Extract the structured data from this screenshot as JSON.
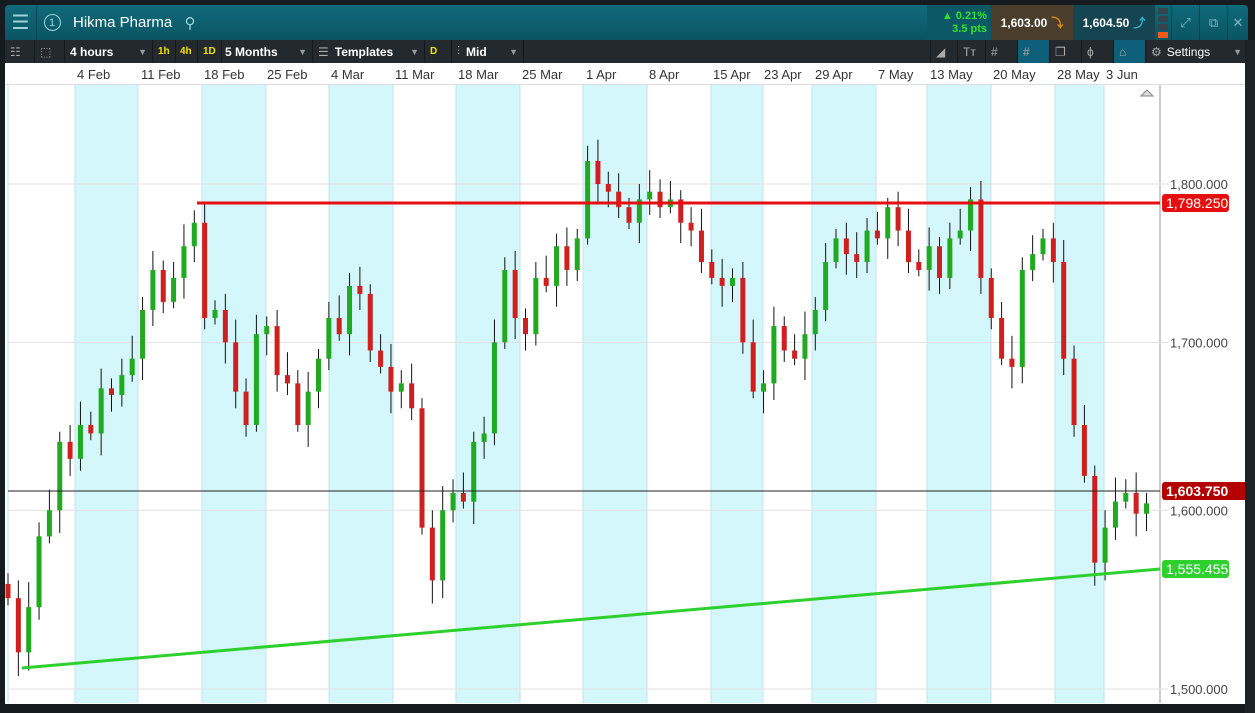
{
  "title": {
    "instrument": "Hikma Pharma",
    "watch_count": "1",
    "change_pct": "▲ 0.21%",
    "change_pts": "3.5 pts",
    "sell": "1,603.00",
    "buy": "1,604.50"
  },
  "toolbar": {
    "interval": "4 hours",
    "q1": "1h",
    "q2": "4h",
    "q3": "1D",
    "range": "5 Months",
    "templates": "Templates",
    "d": "D",
    "price_type": "Mid",
    "settings": "Settings"
  },
  "date_labels": [
    "4 Feb",
    "11 Feb",
    "18 Feb",
    "25 Feb",
    "4 Mar",
    "11 Mar",
    "18 Mar",
    "25 Mar",
    "1 Apr",
    "8 Apr",
    "15 Apr",
    "23 Apr",
    "29 Apr",
    "7 May",
    "13 May",
    "20 May",
    "28 May",
    "3 Jun"
  ],
  "chart_data": {
    "type": "candlestick",
    "y_ticks": [
      "1,800.000",
      "1,700.000",
      "1,600.000",
      "1,500.000"
    ],
    "y_tick_values": [
      1800,
      1700,
      1600,
      1500
    ],
    "ylim": [
      1490,
      1870
    ],
    "scale": "log",
    "resistance": {
      "label": "1,798.250",
      "value": 1798.25,
      "color": "#e60f0f"
    },
    "support": {
      "label": "1,555.455",
      "value": 1555.455,
      "color": "#2dd02d"
    },
    "current": {
      "label": "1,603.750",
      "value": 1603.75,
      "color": "#b30000"
    },
    "closes": [
      1550,
      1520,
      1545,
      1585,
      1600,
      1640,
      1630,
      1650,
      1645,
      1672,
      1668,
      1680,
      1690,
      1720,
      1745,
      1725,
      1740,
      1760,
      1775,
      1715,
      1720,
      1700,
      1670,
      1650,
      1705,
      1710,
      1680,
      1675,
      1650,
      1670,
      1690,
      1715,
      1705,
      1735,
      1730,
      1695,
      1685,
      1670,
      1675,
      1660,
      1590,
      1560,
      1600,
      1610,
      1605,
      1640,
      1645,
      1700,
      1745,
      1715,
      1705,
      1740,
      1735,
      1760,
      1745,
      1765,
      1815,
      1800,
      1795,
      1785,
      1775,
      1790,
      1795,
      1785,
      1790,
      1775,
      1770,
      1750,
      1740,
      1735,
      1740,
      1700,
      1670,
      1675,
      1710,
      1695,
      1690,
      1705,
      1720,
      1750,
      1765,
      1755,
      1750,
      1770,
      1765,
      1785,
      1770,
      1750,
      1745,
      1760,
      1740,
      1765,
      1770,
      1790,
      1740,
      1715,
      1690,
      1685,
      1745,
      1755,
      1765,
      1750,
      1690,
      1650,
      1620,
      1570,
      1590,
      1605,
      1610,
      1598,
      1604
    ],
    "up_color": "#1faa1f",
    "down_color": "#d01f1f"
  }
}
